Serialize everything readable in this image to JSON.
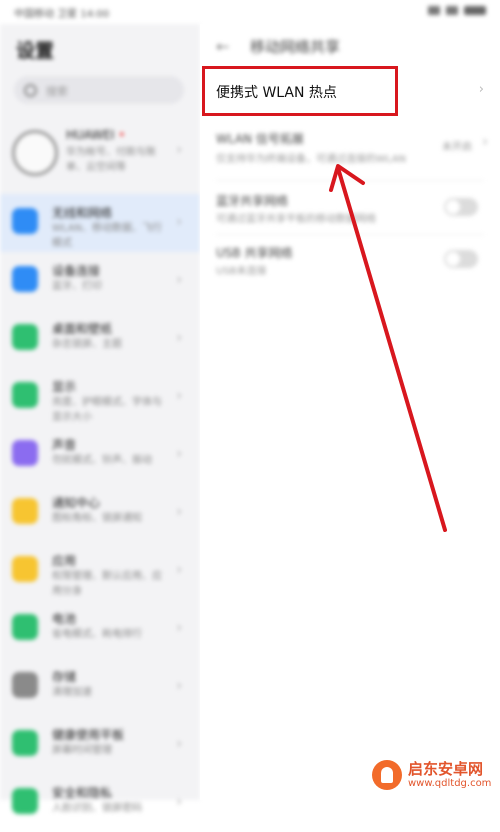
{
  "status": {
    "left": "中国移动 卫星 14:00"
  },
  "left": {
    "title": "设置",
    "search_placeholder": "搜索",
    "account": {
      "name": "HUAWEI",
      "badge": "•",
      "sub": "华为帐号、付款与账单、云空间等"
    },
    "items": [
      {
        "title": "无线和网络",
        "sub": "WLAN、移动数据、飞行模式",
        "color": "#2f8cf5",
        "active": true
      },
      {
        "title": "设备连接",
        "sub": "蓝牙、打印",
        "color": "#2f8cf5",
        "active": false
      },
      {
        "title": "桌面和壁纸",
        "sub": "杂志锁屏、主题",
        "color": "#2fbf71",
        "active": false
      },
      {
        "title": "显示",
        "sub": "亮度、护眼模式、字体与显示大小",
        "color": "#2fbf71",
        "active": false
      },
      {
        "title": "声音",
        "sub": "勿扰模式、铃声、振动",
        "color": "#8b6cf0",
        "active": false
      },
      {
        "title": "通知中心",
        "sub": "图标角标、锁屏通知",
        "color": "#f7c531",
        "active": false
      },
      {
        "title": "应用",
        "sub": "权限管理、默认应用、应用分身",
        "color": "#f7c531",
        "active": false
      },
      {
        "title": "电池",
        "sub": "省电模式、耗电排行",
        "color": "#2fbf71",
        "active": false
      },
      {
        "title": "存储",
        "sub": "清理加速",
        "color": "#8a8a8a",
        "active": false
      },
      {
        "title": "健康使用平板",
        "sub": "屏幕时间管理",
        "color": "#2fbf71",
        "active": false
      },
      {
        "title": "安全和隐私",
        "sub": "人脸识别、锁屏密码",
        "color": "#2fbf71",
        "active": false
      }
    ]
  },
  "right": {
    "header_title": "移动网络共享",
    "hotspot_label": "便携式 WLAN 热点",
    "rows": [
      {
        "title": "WLAN 信号拓展",
        "sub": "仅支持华为终端设备，可通过连接的WLAN",
        "value": "未开启",
        "toggle": false
      },
      {
        "title": "蓝牙共享网络",
        "sub": "可通过蓝牙共享平板的移动数据网络",
        "value": "",
        "toggle": true
      },
      {
        "title": "USB 共享网络",
        "sub": "USB未连接",
        "value": "",
        "toggle": true
      }
    ]
  },
  "watermark": {
    "name": "启东安卓网",
    "url": "www.qdltdg.com"
  },
  "colors": {
    "highlight": "#d8171e",
    "active_bg": "#e1ebfa"
  }
}
